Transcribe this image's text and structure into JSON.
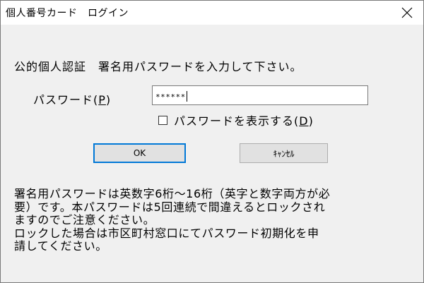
{
  "window": {
    "title": "個人番号カード　ログイン"
  },
  "dialog": {
    "prompt": "公的個人認証　署名用パスワードを入力して下さい。",
    "password_label_prefix": "パスワード(",
    "password_label_key": "P",
    "password_label_suffix": ")",
    "password_value": "******",
    "show_password_label_prefix": "パスワードを表示する(",
    "show_password_key": "D",
    "show_password_label_suffix": ")",
    "show_password_checked": false,
    "ok_label": "OK",
    "cancel_label": "ｷｬﾝｾﾙ",
    "notice_lines": [
      "署名用パスワードは英数字6桁～16桁（英字と数字両方が必",
      "要）です。本パスワードは5回連続で間違えるとロックされ",
      "ますのでご注意ください。",
      "ロックした場合は市区町村窓口にてパスワード初期化を申",
      "請してください。"
    ]
  },
  "colors": {
    "dialog_bg": "#f0f0f0",
    "focus_border": "#0078d7",
    "button_bg": "#e1e1e1"
  },
  "icons": {
    "close": "close-icon"
  }
}
